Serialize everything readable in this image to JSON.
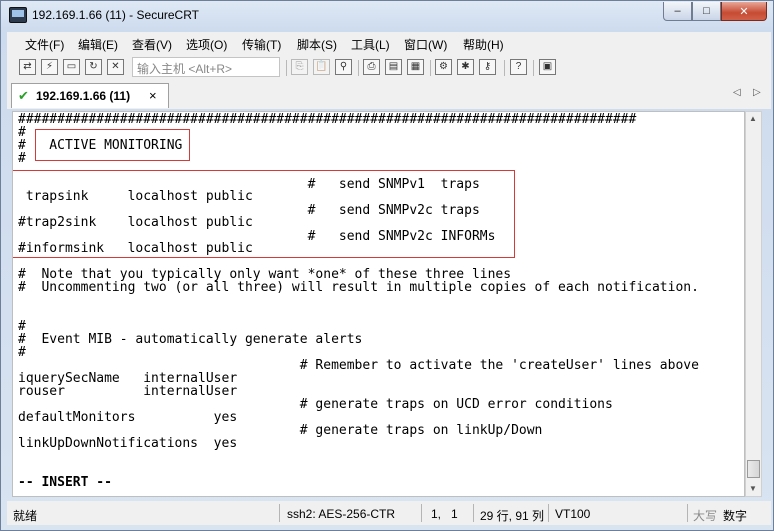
{
  "window": {
    "title": "192.169.1.66 (11) - SecureCRT",
    "controls": {
      "minimize": "–",
      "maximize": "□",
      "close": "✕"
    }
  },
  "menu": [
    "文件(F)",
    "编辑(E)",
    "查看(V)",
    "选项(O)",
    "传输(T)",
    "脚本(S)",
    "工具(L)",
    "窗口(W)",
    "帮助(H)"
  ],
  "toolbar": {
    "quick_connect_placeholder": "输入主机 <Alt+R>",
    "icons": [
      "connect-icon",
      "quick-connect-icon",
      "connect-tab-icon",
      "reconnect-icon",
      "disconnect-icon",
      "copy-icon",
      "paste-icon",
      "find-icon",
      "print-icon",
      "print-setup-icon",
      "log-icon",
      "session-options-icon",
      "global-options-icon",
      "keymap-icon",
      "help-icon",
      "sftp-icon"
    ]
  },
  "tab": {
    "label": "192.169.1.66 (11)",
    "close": "×",
    "status_icon": "check-icon"
  },
  "tab_nav": {
    "left": "◁",
    "right": "▷"
  },
  "terminal": {
    "lines": [
      "###############################################################################",
      "#",
      "#   ACTIVE MONITORING",
      "#",
      "                                     #   send SNMPv1  traps",
      " trapsink     localhost public",
      "                                     #   send SNMPv2c traps",
      "#trap2sink    localhost public",
      "                                     #   send SNMPv2c INFORMs",
      "#informsink   localhost public",
      "#  Note that you typically only want *one* of these three lines",
      "#  Uncommenting two (or all three) will result in multiple copies of each notification.",
      "",
      "",
      "#",
      "#  Event MIB - automatically generate alerts",
      "#",
      "                                    # Remember to activate the 'createUser' lines above",
      "iquerySecName   internalUser",
      "rouser          internalUser",
      "                                    # generate traps on UCD error conditions",
      "defaultMonitors          yes",
      "                                    # generate traps on linkUp/Down",
      "linkUpDownNotifications  yes",
      "",
      "-- INSERT --"
    ]
  },
  "status": {
    "ready": "就绪",
    "cipher": "ssh2: AES-256-CTR",
    "cursor": "1,   1",
    "size": "29 行, 91 列",
    "emulation": "VT100",
    "caps": "大写",
    "num": "数字"
  },
  "colors": {
    "highlight_box": "#d43a3a",
    "tab_check": "#2aa02a"
  }
}
